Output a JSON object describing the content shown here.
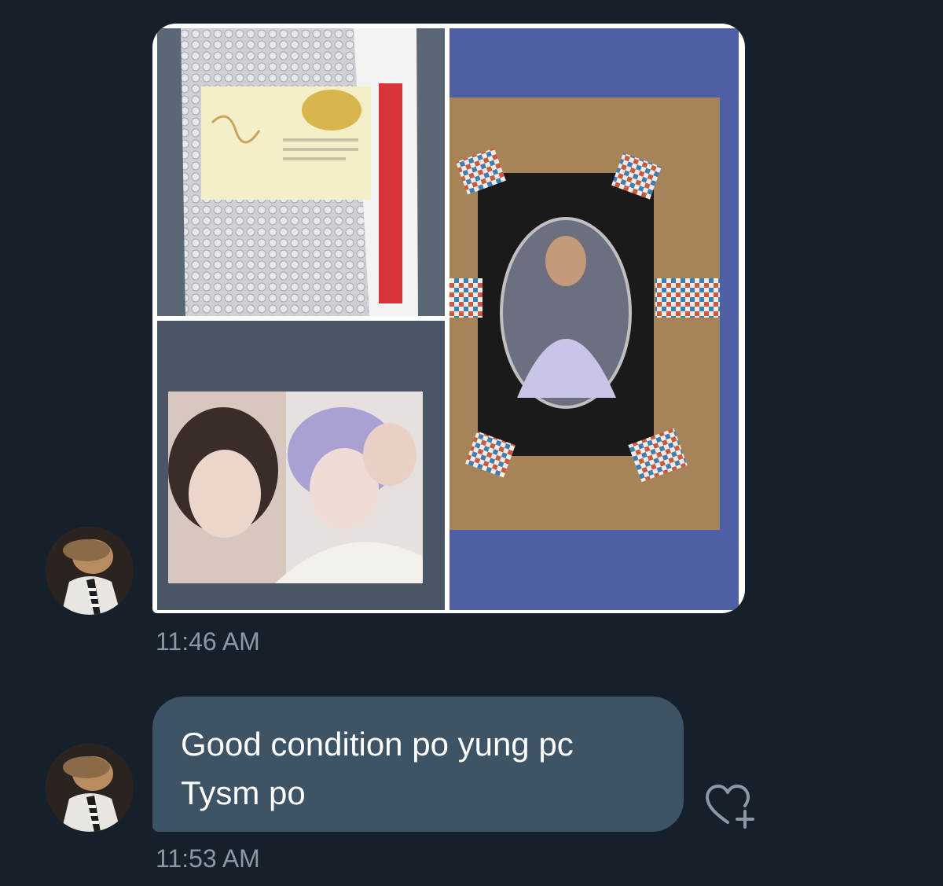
{
  "messages": [
    {
      "type": "image",
      "avatar": "user-avatar",
      "images": [
        {
          "name": "bubble-wrap-package-photo"
        },
        {
          "name": "photocard-duo-photo"
        },
        {
          "name": "framed-photocard-photo"
        }
      ],
      "timestamp": "11:46 AM"
    },
    {
      "type": "text",
      "avatar": "user-avatar",
      "lines": [
        "Good condition po yung pc",
        "Tysm po"
      ],
      "timestamp": "11:53 AM",
      "reaction_icon": "heart-plus-icon"
    }
  ],
  "colors": {
    "background": "#15202b",
    "bubble": "#3d5466",
    "timestamp": "#8b98a5",
    "text": "#ffffff"
  }
}
